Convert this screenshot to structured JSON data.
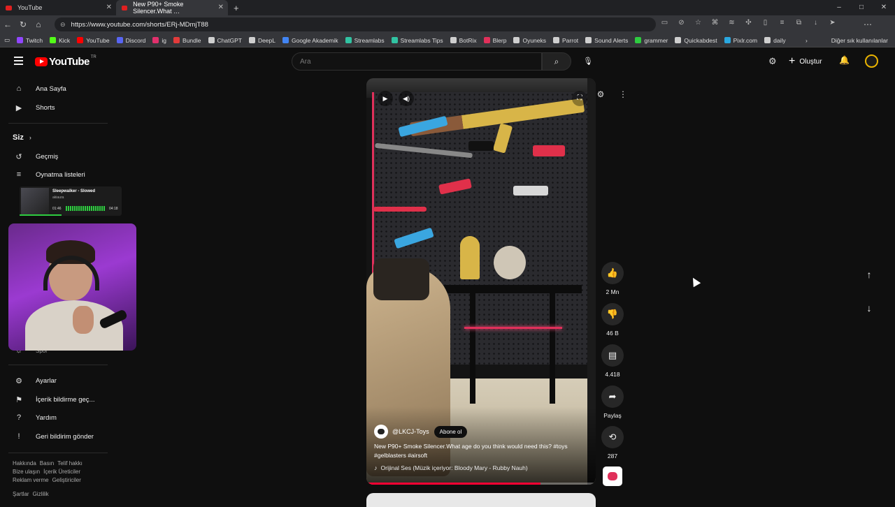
{
  "browser": {
    "tabs": [
      {
        "label": "YouTube"
      },
      {
        "label": "New P90+ Smoke Silencer.What …"
      }
    ],
    "new_tab_icon": "plus-icon",
    "window_controls": [
      "–",
      "□",
      "✕"
    ],
    "url": "https://www.youtube.com/shorts/ERj-MDmjT88",
    "bookmarks": [
      {
        "label": "Twitch",
        "color": "#9146ff"
      },
      {
        "label": "Kick",
        "color": "#53fc18"
      },
      {
        "label": "YouTube",
        "color": "#ff0000"
      },
      {
        "label": "Discord",
        "color": "#5865f2"
      },
      {
        "label": "ig",
        "color": "#e1306c"
      },
      {
        "label": "Bundle",
        "color": "#e23b3b"
      },
      {
        "label": "ChatGPT",
        "color": "#cfcfcf"
      },
      {
        "label": "DeepL",
        "color": "#cfcfcf"
      },
      {
        "label": "Google Akademik",
        "color": "#4285f4"
      },
      {
        "label": "Streamlabs",
        "color": "#31c3a2"
      },
      {
        "label": "Streamlabs Tips",
        "color": "#31c3a2"
      },
      {
        "label": "BotRix",
        "color": "#cfcfcf"
      },
      {
        "label": "Blerp",
        "color": "#e0305a"
      },
      {
        "label": "Oyuneks",
        "color": "#cfcfcf"
      },
      {
        "label": "Parrot",
        "color": "#cfcfcf"
      },
      {
        "label": "Sound Alerts",
        "color": "#cfcfcf"
      },
      {
        "label": "grammer",
        "color": "#2ecc40"
      },
      {
        "label": "Quickabdest",
        "color": "#cfcfcf"
      },
      {
        "label": "Pixlr.com",
        "color": "#2aa8e0"
      },
      {
        "label": "daily",
        "color": "#cfcfcf"
      }
    ],
    "other_bookmarks": "Diğer sık kullanılanlar"
  },
  "header": {
    "logo_text": "YouTube",
    "country_code": "TR",
    "search_placeholder": "Ara",
    "create_label": "Oluştur"
  },
  "sidebar": {
    "items_top": [
      {
        "label": "Ana Sayfa",
        "icon": "home-icon"
      },
      {
        "label": "Shorts",
        "icon": "shorts-icon"
      }
    ],
    "you_heading": "Siz",
    "items_you": [
      {
        "label": "Geçmiş",
        "icon": "history-icon"
      },
      {
        "label": "Oynatma listeleri",
        "icon": "playlist-icon"
      }
    ],
    "partial_label": "Spor",
    "items_bottom": [
      {
        "label": "Ayarlar",
        "icon": "gear-icon"
      },
      {
        "label": "İçerik bildirme geç...",
        "icon": "flag-icon"
      },
      {
        "label": "Yardım",
        "icon": "help-icon"
      },
      {
        "label": "Geri bildirim gönder",
        "icon": "feedback-icon"
      }
    ],
    "footer_links_1": [
      "Hakkında",
      "Basın",
      "Telif hakkı"
    ],
    "footer_links_2": [
      "Bize ulaşın",
      "İçerik Üreticiler"
    ],
    "footer_links_3": [
      "Reklam verme",
      "Geliştiriciler"
    ],
    "footer_links_4": [
      "Şartlar",
      "Gizlilik"
    ]
  },
  "music_overlay": {
    "title": "Sleepwalker - Slowed",
    "artist": "akiaura",
    "current_time": "01:46",
    "total_time": "04:18",
    "progress": 0.41
  },
  "short": {
    "channel": "@LKCJ-Toys",
    "subscribe_label": "Abone ol",
    "title": "New P90+ Smoke Silencer.What age do you think would need this? #toys #gelblasters #airsoft",
    "sound": "Orijinal Ses (Müzik içeriyor: Bloody Mary - Rubby Nauh)",
    "progress": 0.76
  },
  "actions": [
    {
      "icon": "like-icon",
      "label": "2 Mn"
    },
    {
      "icon": "dislike-icon",
      "label": "46 B"
    },
    {
      "icon": "comment-icon",
      "label": "4.418"
    },
    {
      "icon": "share-icon",
      "label": "Paylaş"
    },
    {
      "icon": "remix-icon",
      "label": "287"
    }
  ]
}
